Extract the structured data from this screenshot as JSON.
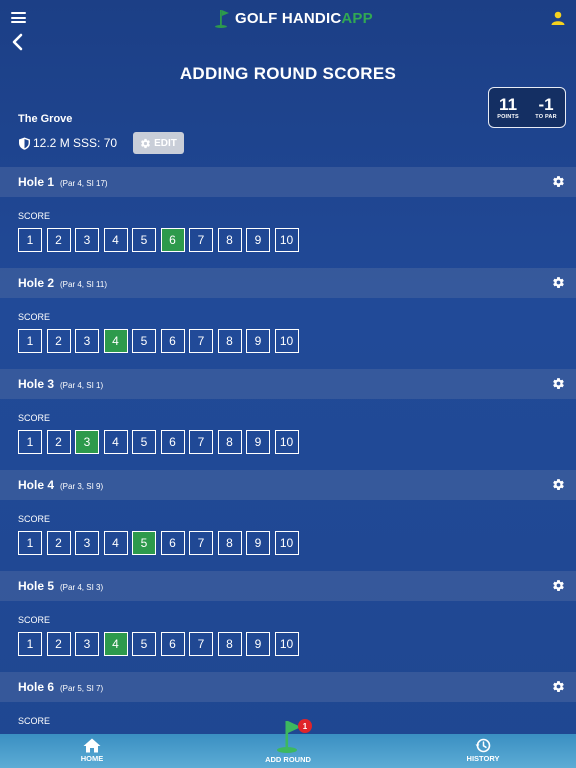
{
  "app": {
    "logo_main": "GOLF HANDIC",
    "logo_accent": "APP"
  },
  "page": {
    "title": "ADDING ROUND SCORES"
  },
  "stats": [
    {
      "value": "11",
      "label": "POINTS"
    },
    {
      "value": "-1",
      "label": "TO PAR"
    }
  ],
  "course": {
    "name": "The Grove",
    "info": "12.2 M  SSS: 70",
    "edit_label": "EDIT"
  },
  "score_label": "SCORE",
  "score_options": [
    "1",
    "2",
    "3",
    "4",
    "5",
    "6",
    "7",
    "8",
    "9",
    "10"
  ],
  "holes": [
    {
      "title": "Hole 1",
      "meta": "(Par 4, SI 17)",
      "selected": 6
    },
    {
      "title": "Hole 2",
      "meta": "(Par 4, SI 11)",
      "selected": 4
    },
    {
      "title": "Hole 3",
      "meta": "(Par 4, SI 1)",
      "selected": 3
    },
    {
      "title": "Hole 4",
      "meta": "(Par 3, SI 9)",
      "selected": 5
    },
    {
      "title": "Hole 5",
      "meta": "(Par 4, SI 3)",
      "selected": 4
    },
    {
      "title": "Hole 6",
      "meta": "(Par 5, SI 7)",
      "selected": null
    }
  ],
  "nav": {
    "home": "HOME",
    "add_round": "ADD ROUND",
    "history": "HISTORY",
    "badge": "1"
  },
  "icons": [
    "menu-icon",
    "flag-icon",
    "user-icon",
    "back-icon",
    "shield-icon",
    "gear-icon",
    "home-icon",
    "history-icon"
  ],
  "colors": {
    "accent_green": "#2d9a4c",
    "logo_yellow": "#f5d21f",
    "badge_red": "#e0242a"
  }
}
